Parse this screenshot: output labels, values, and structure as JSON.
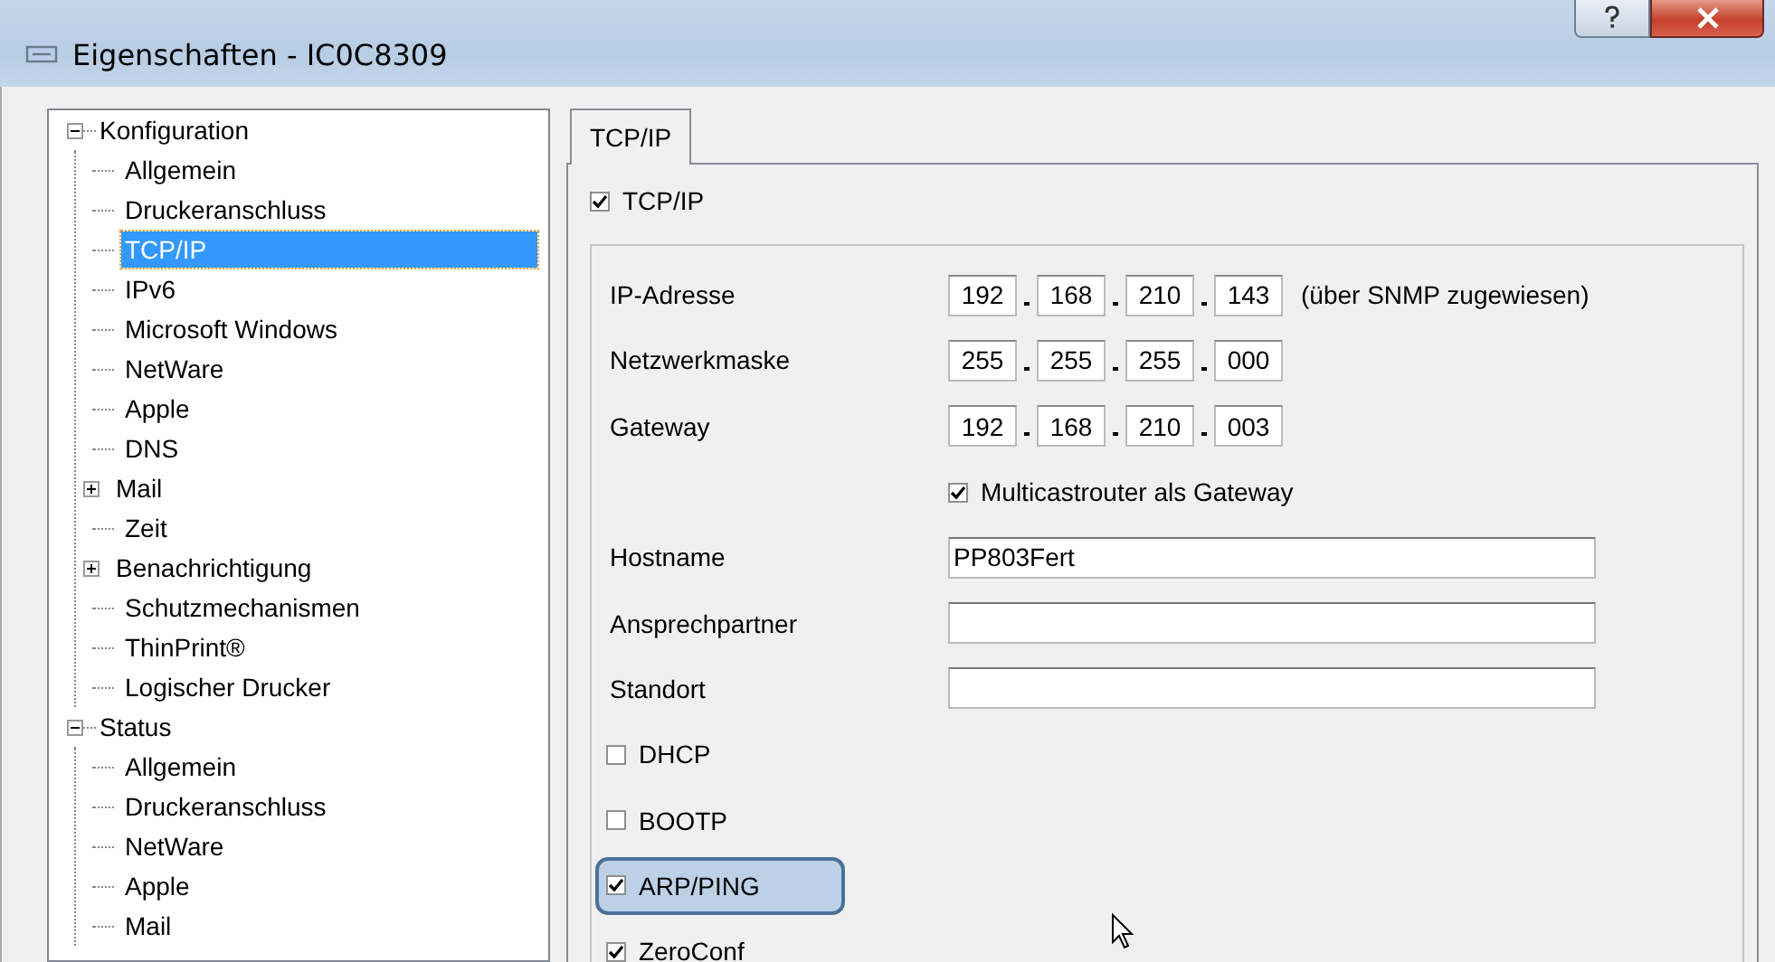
{
  "window": {
    "title": "Eigenschaften - IC0C8309"
  },
  "tree": [
    {
      "label": "Konfiguration",
      "expanded": true,
      "selected": false,
      "children": [
        {
          "label": "Allgemein",
          "selected": false
        },
        {
          "label": "Druckeranschluss",
          "selected": false
        },
        {
          "label": "TCP/IP",
          "selected": true
        },
        {
          "label": "IPv6",
          "selected": false
        },
        {
          "label": "Microsoft Windows",
          "selected": false
        },
        {
          "label": "NetWare",
          "selected": false
        },
        {
          "label": "Apple",
          "selected": false
        },
        {
          "label": "DNS",
          "selected": false
        },
        {
          "label": "Mail",
          "selected": false,
          "expanded": false
        },
        {
          "label": "Zeit",
          "selected": false
        },
        {
          "label": "Benachrichtigung",
          "selected": false,
          "expanded": false
        },
        {
          "label": "Schutzmechanismen",
          "selected": false
        },
        {
          "label": "ThinPrint®",
          "selected": false
        },
        {
          "label": "Logischer Drucker",
          "selected": false
        }
      ]
    },
    {
      "label": "Status",
      "expanded": true,
      "selected": false,
      "children": [
        {
          "label": "Allgemein",
          "selected": false
        },
        {
          "label": "Druckeranschluss",
          "selected": false
        },
        {
          "label": "NetWare",
          "selected": false
        },
        {
          "label": "Apple",
          "selected": false
        },
        {
          "label": "Mail",
          "selected": false
        }
      ]
    }
  ],
  "tabs": [
    {
      "label": "TCP/IP",
      "selected": true
    }
  ],
  "tcpip": {
    "label": "TCP/IP",
    "checked": true
  },
  "address_fields": [
    {
      "label": "IP-Adresse",
      "octets": [
        "192",
        "168",
        "210",
        "143"
      ],
      "note": "(über SNMP zugewiesen)"
    },
    {
      "label": "Netzwerkmaske",
      "octets": [
        "255",
        "255",
        "255",
        "000"
      ]
    },
    {
      "label": "Gateway",
      "octets": [
        "192",
        "168",
        "210",
        "003"
      ]
    }
  ],
  "multicast": {
    "label": "Multicastrouter als Gateway",
    "checked": true
  },
  "text_fields": [
    {
      "label": "Hostname",
      "value": "PP803Fert"
    },
    {
      "label": "Ansprechpartner"
    },
    {
      "label": "Standort"
    }
  ],
  "protocols": [
    {
      "label": "DHCP",
      "checked": false,
      "highlighted": false
    },
    {
      "label": "BOOTP",
      "checked": false,
      "highlighted": false
    },
    {
      "label": "ARP/PING",
      "checked": true,
      "highlighted": true
    },
    {
      "label": "ZeroConf",
      "checked": true,
      "highlighted": false
    }
  ]
}
